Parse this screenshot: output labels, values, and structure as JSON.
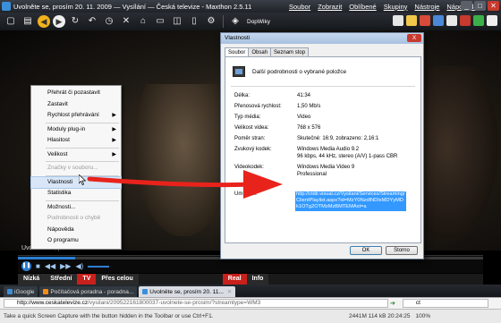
{
  "window": {
    "title": "Uvolněte se, prosím 20. 11. 2009 — Vysílání — Česká televize - Maxthon 2.5.11",
    "menu": [
      "Soubor",
      "Zobrazit",
      "Oblíbené",
      "Skupiny",
      "Nástroje",
      "Nápověda"
    ]
  },
  "toolbar": {
    "dopwiky_label": "DopWiky"
  },
  "video": {
    "caption": "Uvolněte se, prosím",
    "quality": [
      "Nízká",
      "Střední",
      "TV",
      "Přes celou",
      "Real",
      "Info"
    ]
  },
  "context_menu": {
    "items": [
      {
        "label": "Přehrát či pozastavit",
        "disabled": false,
        "submenu": false
      },
      {
        "label": "Zastavit",
        "disabled": false,
        "submenu": false
      },
      {
        "label": "Rychlost přehrávání",
        "disabled": false,
        "submenu": true
      },
      {
        "label": "Moduly plug-in",
        "disabled": false,
        "submenu": true
      },
      {
        "label": "Hlasitost",
        "disabled": false,
        "submenu": true
      },
      {
        "label": "Velikost",
        "disabled": false,
        "submenu": true
      },
      {
        "label": "Značky v souboru...",
        "disabled": true,
        "submenu": false
      },
      {
        "label": "Vlastnosti",
        "disabled": false,
        "submenu": false,
        "highlight": true
      },
      {
        "label": "Statistika",
        "disabled": false,
        "submenu": false
      },
      {
        "label": "Možnosti...",
        "disabled": false,
        "submenu": false
      },
      {
        "label": "Podrobnosti o chybě",
        "disabled": true,
        "submenu": false
      },
      {
        "label": "Nápověda",
        "disabled": false,
        "submenu": false
      },
      {
        "label": "O programu",
        "disabled": false,
        "submenu": false
      }
    ]
  },
  "dialog": {
    "title": "Vlastnosti",
    "close_label": "X",
    "tabs": [
      "Soubor",
      "Obsah",
      "Seznam stop"
    ],
    "header": "Další podrobnosti o vybrané položce",
    "rows": [
      {
        "k": "Délka:",
        "v": "41:34"
      },
      {
        "k": "Přenosová rychlost:",
        "v": "1,50 Mb/s"
      },
      {
        "k": "Typ média:",
        "v": "Video"
      },
      {
        "k": "Velikost videa:",
        "v": "768 x 576"
      },
      {
        "k": "Poměr stran:",
        "v": "Skutečné: 16:9, zobrazeno: 2,16:1"
      },
      {
        "k": "Zvukový kodek:",
        "v": "Windows Media Audio 9.2"
      },
      {
        "k": "",
        "v": "96 kbps, 44 kHz, stereo (A/V) 1-pass CBR"
      },
      {
        "k": "Videokodek:",
        "v": "Windows Media Video 9"
      },
      {
        "k": "",
        "v": "Professional"
      },
      {
        "k": "Umístění:",
        "v": ""
      }
    ],
    "location_url": "http://ctdir.visual.cz/Vysilani/Services/Streaming/ClientPlaylist.aspx?id=MzY0NzdlNDIxMDYyMDk1OTg2OTMzMzBMTEMAxt=a",
    "ok_label": "OK",
    "cancel_label": "Storno"
  },
  "tabs": [
    {
      "label": "iGoogle",
      "active": false
    },
    {
      "label": "Počítačová poradna - poradna...",
      "active": false
    },
    {
      "label": "Uvolněte se, prosím 20. 11...",
      "active": true
    }
  ],
  "address": {
    "url_host": "http://www.ceskatelevize.cz",
    "url_rest": "/vysilani/209522161800037-uvolnete-se-prosim/?streamtype=WM3",
    "search_value": "ct"
  },
  "status": {
    "tip": "Take a quick Screen Capture with the button hidden in the Toolbar or use Ctrl+F1.",
    "stats": "2441M 114 kB 20:24:25",
    "zoom": "100%"
  }
}
